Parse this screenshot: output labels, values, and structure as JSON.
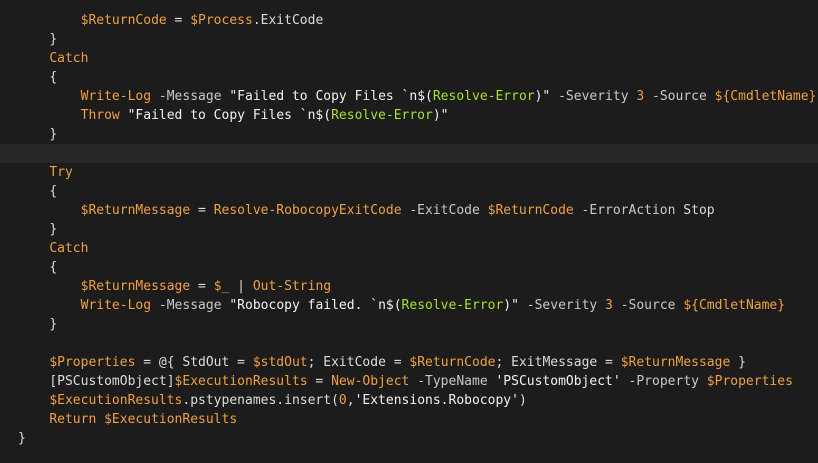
{
  "editor": {
    "lines": [
      {
        "indent": "        ",
        "tokens": [
          {
            "t": "var",
            "v": "$ReturnCode"
          },
          {
            "t": "op",
            "v": " = "
          },
          {
            "t": "var",
            "v": "$Process"
          },
          {
            "t": "plain",
            "v": ".ExitCode"
          }
        ]
      },
      {
        "indent": "    ",
        "tokens": [
          {
            "t": "punc",
            "v": "}"
          }
        ]
      },
      {
        "indent": "    ",
        "tokens": [
          {
            "t": "kw",
            "v": "Catch"
          }
        ]
      },
      {
        "indent": "    ",
        "tokens": [
          {
            "t": "punc",
            "v": "{"
          }
        ]
      },
      {
        "indent": "        ",
        "tokens": [
          {
            "t": "cmd",
            "v": "Write-Log"
          },
          {
            "t": "param",
            "v": " -Message "
          },
          {
            "t": "str",
            "v": "\"Failed to Copy Files `n$("
          },
          {
            "t": "fn",
            "v": "Resolve-Error"
          },
          {
            "t": "str",
            "v": ")\""
          },
          {
            "t": "param",
            "v": " -Severity "
          },
          {
            "t": "num",
            "v": "3"
          },
          {
            "t": "param",
            "v": " -Source "
          },
          {
            "t": "strvar",
            "v": "${CmdletName}"
          }
        ]
      },
      {
        "indent": "        ",
        "tokens": [
          {
            "t": "kw",
            "v": "Throw"
          },
          {
            "t": "str",
            "v": " \"Failed to Copy Files `n$("
          },
          {
            "t": "fn",
            "v": "Resolve-Error"
          },
          {
            "t": "str",
            "v": ")\""
          }
        ]
      },
      {
        "indent": "    ",
        "tokens": [
          {
            "t": "punc",
            "v": "}"
          }
        ]
      },
      {
        "indent": "",
        "current": true,
        "tokens": []
      },
      {
        "indent": "    ",
        "tokens": [
          {
            "t": "kw",
            "v": "Try"
          }
        ]
      },
      {
        "indent": "    ",
        "tokens": [
          {
            "t": "punc",
            "v": "{"
          }
        ]
      },
      {
        "indent": "        ",
        "tokens": [
          {
            "t": "var",
            "v": "$ReturnMessage"
          },
          {
            "t": "op",
            "v": " = "
          },
          {
            "t": "cmd",
            "v": "Resolve-RobocopyExitCode"
          },
          {
            "t": "param",
            "v": " -ExitCode "
          },
          {
            "t": "var",
            "v": "$ReturnCode"
          },
          {
            "t": "param",
            "v": " -ErrorAction "
          },
          {
            "t": "plain",
            "v": "Stop"
          }
        ]
      },
      {
        "indent": "    ",
        "tokens": [
          {
            "t": "punc",
            "v": "}"
          }
        ]
      },
      {
        "indent": "    ",
        "tokens": [
          {
            "t": "kw",
            "v": "Catch"
          }
        ]
      },
      {
        "indent": "    ",
        "tokens": [
          {
            "t": "punc",
            "v": "{"
          }
        ]
      },
      {
        "indent": "        ",
        "tokens": [
          {
            "t": "var",
            "v": "$ReturnMessage"
          },
          {
            "t": "op",
            "v": " = "
          },
          {
            "t": "var",
            "v": "$_"
          },
          {
            "t": "op",
            "v": " | "
          },
          {
            "t": "cmd",
            "v": "Out-String"
          }
        ]
      },
      {
        "indent": "        ",
        "tokens": [
          {
            "t": "cmd",
            "v": "Write-Log"
          },
          {
            "t": "param",
            "v": " -Message "
          },
          {
            "t": "str",
            "v": "\"Robocopy failed. `n$("
          },
          {
            "t": "fn",
            "v": "Resolve-Error"
          },
          {
            "t": "str",
            "v": ")\""
          },
          {
            "t": "param",
            "v": " -Severity "
          },
          {
            "t": "num",
            "v": "3"
          },
          {
            "t": "param",
            "v": " -Source "
          },
          {
            "t": "strvar",
            "v": "${CmdletName}"
          }
        ]
      },
      {
        "indent": "    ",
        "tokens": [
          {
            "t": "punc",
            "v": "}"
          }
        ]
      },
      {
        "indent": "",
        "tokens": []
      },
      {
        "indent": "    ",
        "tokens": [
          {
            "t": "var",
            "v": "$Properties"
          },
          {
            "t": "op",
            "v": " = @{ "
          },
          {
            "t": "plain",
            "v": "StdOut"
          },
          {
            "t": "op",
            "v": " = "
          },
          {
            "t": "var",
            "v": "$stdOut"
          },
          {
            "t": "op",
            "v": "; "
          },
          {
            "t": "plain",
            "v": "ExitCode"
          },
          {
            "t": "op",
            "v": " = "
          },
          {
            "t": "var",
            "v": "$ReturnCode"
          },
          {
            "t": "op",
            "v": "; "
          },
          {
            "t": "plain",
            "v": "ExitMessage"
          },
          {
            "t": "op",
            "v": " = "
          },
          {
            "t": "var",
            "v": "$ReturnMessage"
          },
          {
            "t": "op",
            "v": " }"
          }
        ]
      },
      {
        "indent": "    ",
        "tokens": [
          {
            "t": "type",
            "v": "[PSCustomObject]"
          },
          {
            "t": "var",
            "v": "$ExecutionResults"
          },
          {
            "t": "op",
            "v": " = "
          },
          {
            "t": "cmd",
            "v": "New-Object"
          },
          {
            "t": "param",
            "v": " -TypeName "
          },
          {
            "t": "str",
            "v": "'PSCustomObject'"
          },
          {
            "t": "param",
            "v": " -Property "
          },
          {
            "t": "var",
            "v": "$Properties"
          }
        ]
      },
      {
        "indent": "    ",
        "tokens": [
          {
            "t": "var",
            "v": "$ExecutionResults"
          },
          {
            "t": "plain",
            "v": ".pstypenames.insert("
          },
          {
            "t": "num",
            "v": "0"
          },
          {
            "t": "plain",
            "v": ","
          },
          {
            "t": "str",
            "v": "'Extensions.Robocopy'"
          },
          {
            "t": "plain",
            "v": ")"
          }
        ]
      },
      {
        "indent": "    ",
        "tokens": [
          {
            "t": "kw",
            "v": "Return"
          },
          {
            "t": "plain",
            "v": " "
          },
          {
            "t": "var",
            "v": "$ExecutionResults"
          }
        ]
      },
      {
        "indent": "",
        "tokens": [
          {
            "t": "punc",
            "v": "}"
          }
        ]
      }
    ]
  }
}
